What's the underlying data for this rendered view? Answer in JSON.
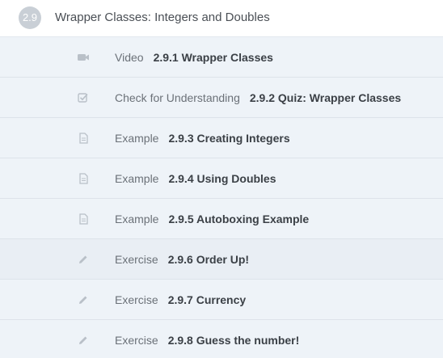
{
  "module": {
    "number": "2.9",
    "title": "Wrapper Classes: Integers and Doubles"
  },
  "items": [
    {
      "type": "Video",
      "name": "2.9.1 Wrapper Classes",
      "icon": "video-icon"
    },
    {
      "type": "Check for Understanding",
      "name": "2.9.2 Quiz: Wrapper Classes",
      "icon": "checkbox-icon"
    },
    {
      "type": "Example",
      "name": "2.9.3 Creating Integers",
      "icon": "document-icon"
    },
    {
      "type": "Example",
      "name": "2.9.4 Using Doubles",
      "icon": "document-icon"
    },
    {
      "type": "Example",
      "name": "2.9.5 Autoboxing Example",
      "icon": "document-icon"
    },
    {
      "type": "Exercise",
      "name": "2.9.6 Order Up!",
      "icon": "pencil-icon"
    },
    {
      "type": "Exercise",
      "name": "2.9.7 Currency",
      "icon": "pencil-icon"
    },
    {
      "type": "Exercise",
      "name": "2.9.8 Guess the number!",
      "icon": "pencil-icon"
    }
  ]
}
